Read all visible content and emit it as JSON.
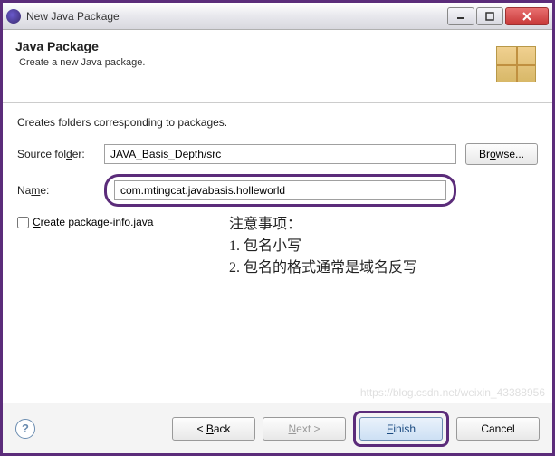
{
  "titlebar": {
    "title": "New Java Package"
  },
  "header": {
    "title": "Java Package",
    "desc": "Create a new Java package."
  },
  "content": {
    "instruction": "Creates folders corresponding to packages.",
    "source_folder_label": "Source folder:",
    "source_folder_value": "JAVA_Basis_Depth/src",
    "browse_label": "Browse...",
    "name_label": "Name:",
    "name_value": "com.mtingcat.javabasis.holleworld",
    "checkbox_label": "Create package-info.java"
  },
  "notes": {
    "line1": "注意事项：",
    "line2": "1. 包名小写",
    "line3": "2. 包名的格式通常是域名反写"
  },
  "footer": {
    "back": "< Back",
    "next": "Next >",
    "finish": "Finish",
    "cancel": "Cancel"
  },
  "watermark": "https://blog.csdn.net/weixin_43388956"
}
